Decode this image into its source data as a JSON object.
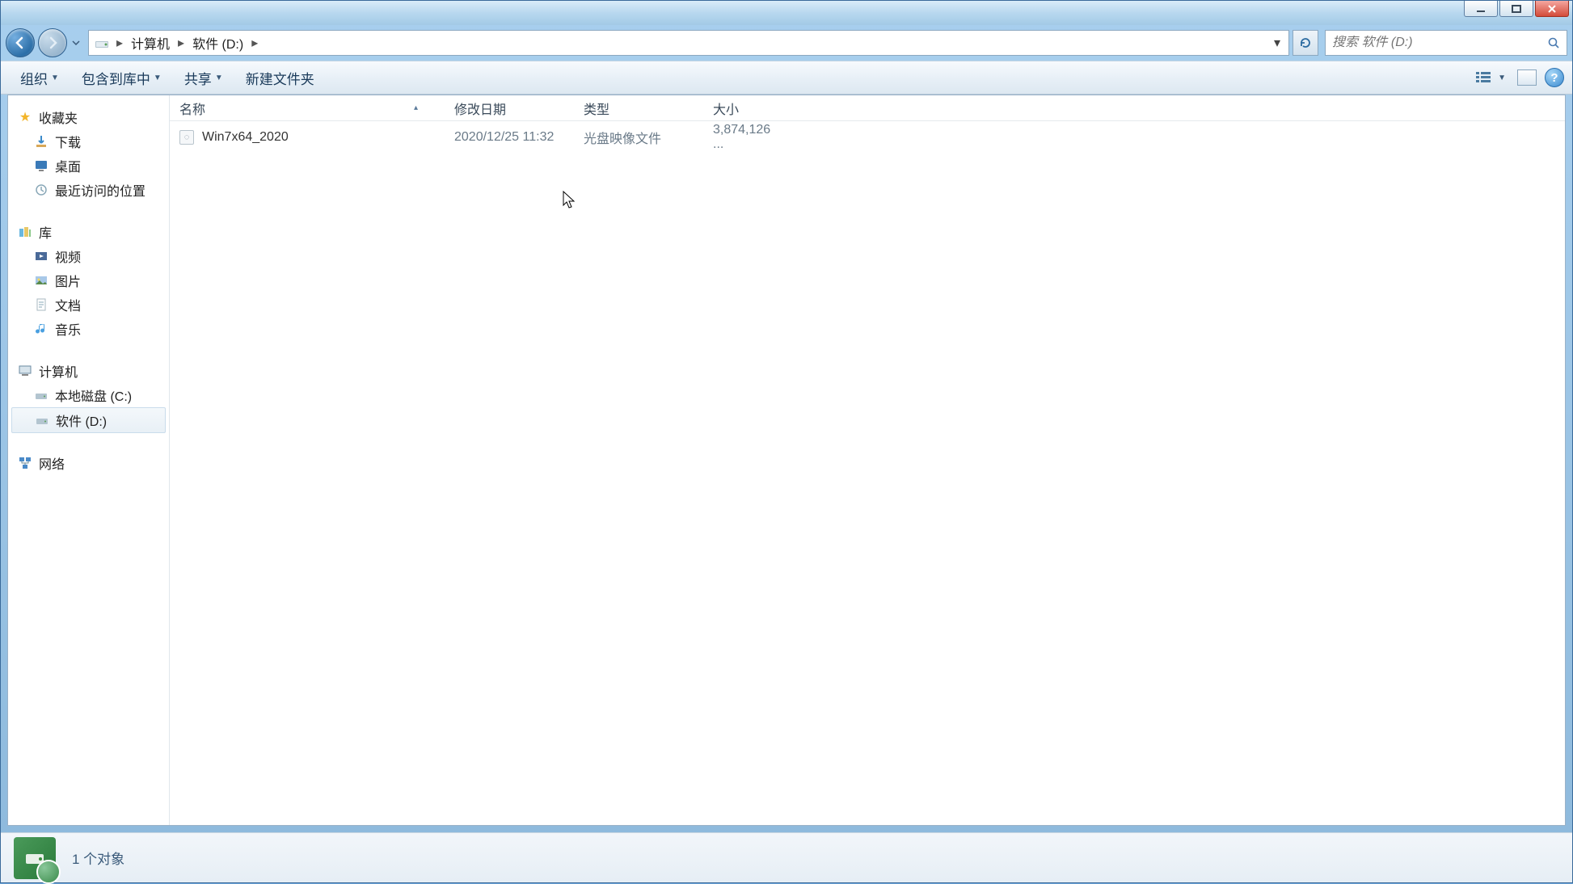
{
  "breadcrumb": {
    "root": "计算机",
    "current": "软件 (D:)"
  },
  "search": {
    "placeholder": "搜索 软件 (D:)"
  },
  "toolbar": {
    "organize": "组织",
    "include": "包含到库中",
    "share": "共享",
    "newfolder": "新建文件夹"
  },
  "columns": {
    "name": "名称",
    "date": "修改日期",
    "type": "类型",
    "size": "大小"
  },
  "files": [
    {
      "name": "Win7x64_2020",
      "date": "2020/12/25 11:32",
      "type": "光盘映像文件",
      "size": "3,874,126 ..."
    }
  ],
  "sidebar": {
    "favorites": {
      "label": "收藏夹",
      "items": [
        "下载",
        "桌面",
        "最近访问的位置"
      ]
    },
    "libraries": {
      "label": "库",
      "items": [
        "视频",
        "图片",
        "文档",
        "音乐"
      ]
    },
    "computer": {
      "label": "计算机",
      "items": [
        "本地磁盘 (C:)",
        "软件 (D:)"
      ]
    },
    "network": {
      "label": "网络"
    }
  },
  "status": {
    "count": "1 个对象"
  }
}
